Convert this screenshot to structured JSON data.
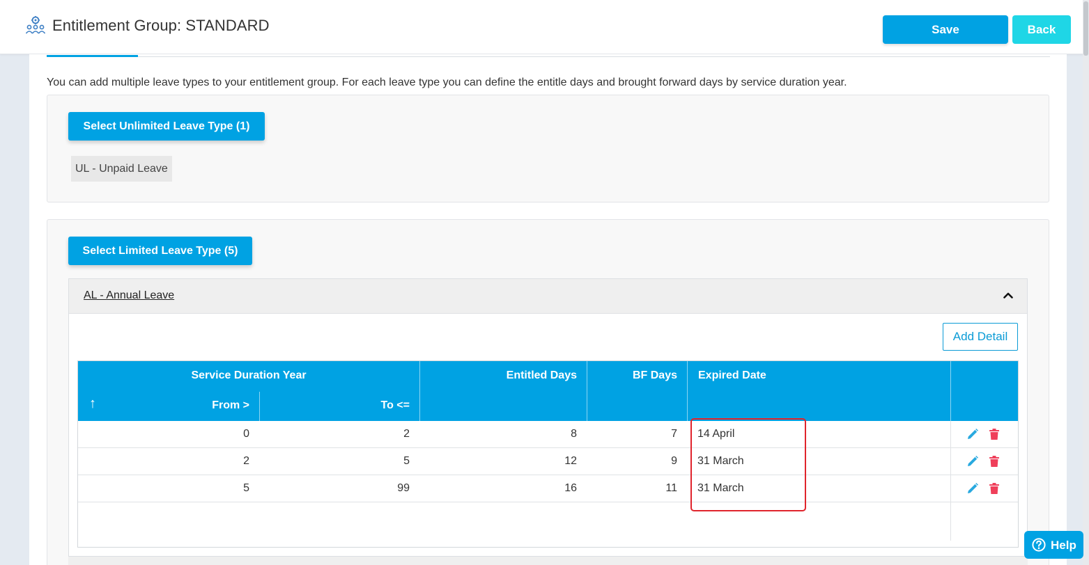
{
  "header": {
    "title": "Entitlement Group: STANDARD",
    "save_label": "Save",
    "back_label": "Back"
  },
  "intro_text": "You can add multiple leave types to your entitlement group. For each leave type you can define the entitle days and brought forward days by service duration year.",
  "unlimited": {
    "button_label": "Select Unlimited Leave Type (1)",
    "items": [
      "UL - Unpaid Leave"
    ]
  },
  "limited": {
    "button_label": "Select Limited Leave Type (5)",
    "accordion": {
      "title": "AL - Annual Leave",
      "add_detail_label": "Add Detail",
      "table": {
        "group_header": "Service Duration Year",
        "sort_indicator": "↑",
        "col_from": "From >",
        "col_to": "To <=",
        "col_entitled": "Entitled Days",
        "col_bf": "BF Days",
        "col_expired": "Expired Date",
        "rows": [
          {
            "from": "0",
            "to": "2",
            "entitled": "8",
            "bf": "7",
            "expired": "14 April"
          },
          {
            "from": "2",
            "to": "5",
            "entitled": "12",
            "bf": "9",
            "expired": "31 March"
          },
          {
            "from": "5",
            "to": "99",
            "entitled": "16",
            "bf": "11",
            "expired": "31 March"
          }
        ]
      }
    }
  },
  "help_label": "Help",
  "colors": {
    "primary": "#00a2e3",
    "back_button": "#1fd6e6",
    "edit_icon": "#29a9df",
    "delete_icon": "#ef3f5a",
    "highlight_border": "#e0242c"
  },
  "icons": {
    "title": "team-settings-icon",
    "accordion": "chevron-up-icon",
    "edit": "pencil-icon",
    "delete": "trash-icon",
    "help": "question-circle-icon"
  }
}
